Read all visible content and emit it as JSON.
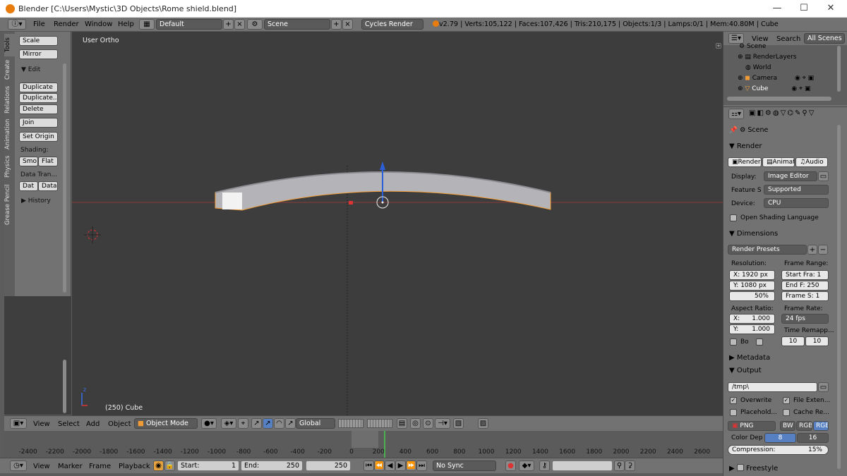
{
  "window": {
    "title": "Blender [C:\\Users\\Mystic\\3D Objects\\Rome shield.blend]",
    "minimize": "—",
    "maximize": "☐",
    "close": "✕"
  },
  "topbar": {
    "menus": [
      "File",
      "Render",
      "Window",
      "Help"
    ],
    "layout": "Default",
    "scene": "Scene",
    "engine": "Cycles Render",
    "stats": "v2.79 | Verts:105,122 | Faces:107,426 | Tris:210,175 | Objects:1/3 | Lamps:0/1 | Mem:40.80M | Cube"
  },
  "tool_tabs": [
    "Tools",
    "Create",
    "Relations",
    "Animation",
    "Physics",
    "Grease Pencil"
  ],
  "toolshelf": {
    "scale": "Scale",
    "mirror": "Mirror",
    "edit_header": "Edit",
    "duplicate": "Duplicate",
    "duplicate_linked": "Duplicate...",
    "delete": "Delete",
    "join": "Join",
    "set_origin": "Set Origin",
    "shading_label": "Shading:",
    "smooth": "Smo",
    "flat": "Flat",
    "data_transfer_label": "Data Tran...",
    "dat": "Dat",
    "data": "Data",
    "history": "History"
  },
  "viewport": {
    "view_label": "User Ortho",
    "object_label": "(250) Cube",
    "axis_z": "z"
  },
  "viewport_header": {
    "view": "View",
    "select": "Select",
    "add": "Add",
    "object": "Object",
    "mode": "Object Mode",
    "orientation": "Global"
  },
  "timeline": {
    "ticks": [
      "-2400",
      "-2200",
      "-2000",
      "-1800",
      "-1600",
      "-1400",
      "-1200",
      "-1000",
      "-800",
      "-600",
      "-400",
      "-200",
      "0",
      "200",
      "400",
      "600",
      "800",
      "1000",
      "1200",
      "1400",
      "1600",
      "1800",
      "2000",
      "2200",
      "2400",
      "2600"
    ],
    "current_frame": 250
  },
  "timeline_bar": {
    "view": "View",
    "marker": "Marker",
    "frame": "Frame",
    "playback": "Playback",
    "start_label": "Start:",
    "start_value": "1",
    "end_label": "End:",
    "end_value": "250",
    "current_frame": "250",
    "sync": "No Sync"
  },
  "outliner": {
    "view": "View",
    "search": "Search",
    "all_scenes": "All Scenes",
    "items": [
      "Scene",
      "RenderLayers",
      "World",
      "Camera",
      "Cube"
    ]
  },
  "properties": {
    "breadcrumb": "Scene",
    "render_header": "Render",
    "render_btn": "Render",
    "animation_btn": "Animati",
    "audio_btn": "Audio",
    "display_label": "Display:",
    "display_value": "Image Editor",
    "feature_label": "Feature S",
    "feature_value": "Supported",
    "device_label": "Device:",
    "device_value": "CPU",
    "osl": "Open Shading Language",
    "dimensions_header": "Dimensions",
    "presets": "Render Presets",
    "resolution_label": "Resolution:",
    "res_x": "X: 1920 px",
    "res_y": "Y: 1080 px",
    "res_pct": "50%",
    "frame_range_label": "Frame Range:",
    "start_frame": "Start Fra: 1",
    "end_frame": "End F: 250",
    "frame_step": "Frame S: 1",
    "aspect_label": "Aspect Ratio:",
    "aspect_x_label": "X:",
    "aspect_x": "1.000",
    "aspect_y_label": "Y:",
    "aspect_y": "1.000",
    "frame_rate_label": "Frame Rate:",
    "frame_rate": "24 fps",
    "time_remap_label": "Time Remapp...",
    "remap_old": "10",
    "remap_new": "10",
    "border": "Bo",
    "metadata_header": "Metadata",
    "output_header": "Output",
    "output_path": "/tmp\\",
    "overwrite": "Overwrite",
    "file_ext": "File Exten...",
    "placeholders": "Placehold...",
    "cache_result": "Cache Re...",
    "format": "PNG",
    "bw": "BW",
    "rgb": "RGB",
    "rgba": "RGB",
    "color_depth_label": "Color Dep",
    "depth_8": "8",
    "depth_16": "16",
    "compression": "Compression:",
    "compression_value": "15%",
    "freestyle_header": "Freestyle"
  },
  "colors": {
    "accent_blue": "#5680c2",
    "selection_orange": "#f19b36",
    "axis_red": "#c23a3a",
    "viewport_bg": "#3d3d3d",
    "panel_bg": "#727272"
  }
}
